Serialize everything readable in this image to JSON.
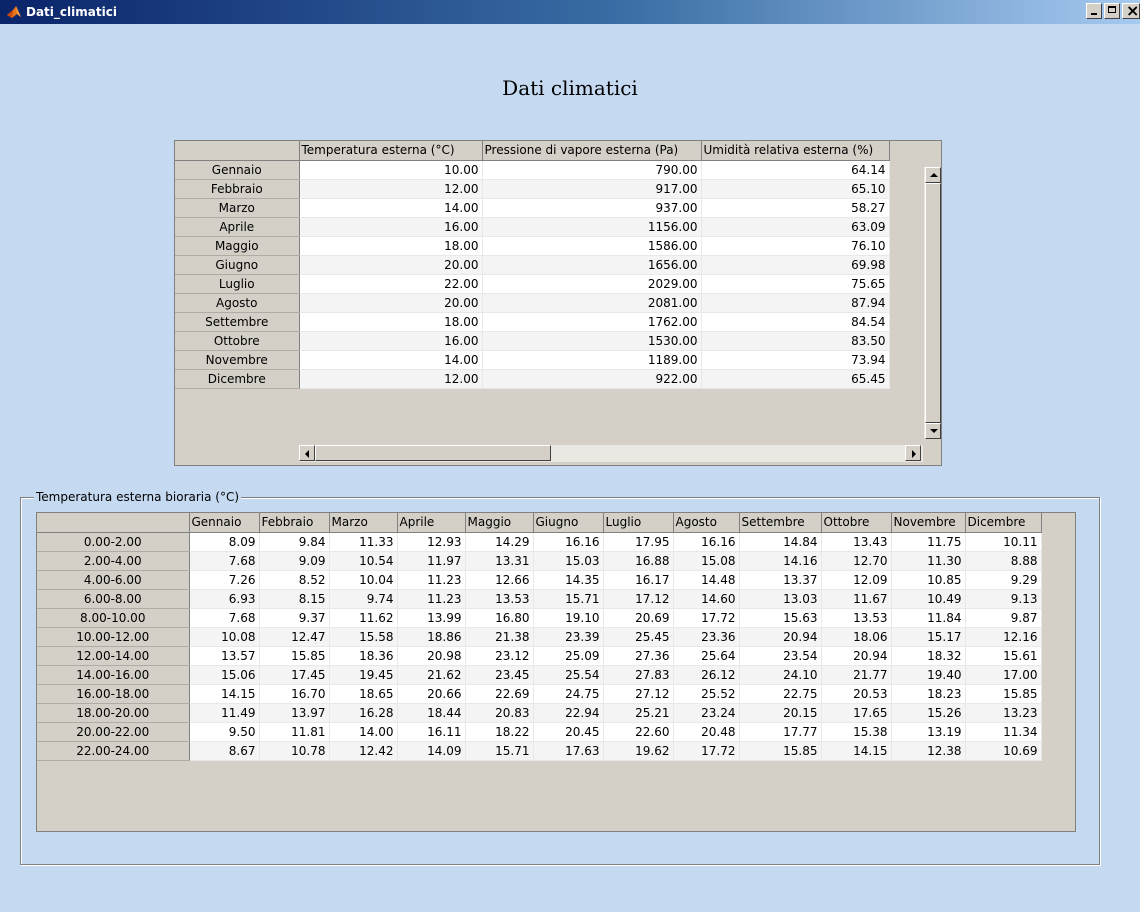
{
  "window": {
    "title": "Dati_climatici",
    "icon": "matlab-icon"
  },
  "heading": "Dati climatici",
  "monthly_table": {
    "columns": [
      "Temperatura esterna  (°C)",
      "Pressione di vapore esterna (Pa)",
      "Umidità relativa esterna (%)"
    ],
    "rows": [
      {
        "label": "Gennaio",
        "values": [
          "10.00",
          "790.00",
          "64.14"
        ]
      },
      {
        "label": "Febbraio",
        "values": [
          "12.00",
          "917.00",
          "65.10"
        ]
      },
      {
        "label": "Marzo",
        "values": [
          "14.00",
          "937.00",
          "58.27"
        ]
      },
      {
        "label": "Aprile",
        "values": [
          "16.00",
          "1156.00",
          "63.09"
        ]
      },
      {
        "label": "Maggio",
        "values": [
          "18.00",
          "1586.00",
          "76.10"
        ]
      },
      {
        "label": "Giugno",
        "values": [
          "20.00",
          "1656.00",
          "69.98"
        ]
      },
      {
        "label": "Luglio",
        "values": [
          "22.00",
          "2029.00",
          "75.65"
        ]
      },
      {
        "label": "Agosto",
        "values": [
          "20.00",
          "2081.00",
          "87.94"
        ]
      },
      {
        "label": "Settembre",
        "values": [
          "18.00",
          "1762.00",
          "84.54"
        ]
      },
      {
        "label": "Ottobre",
        "values": [
          "16.00",
          "1530.00",
          "83.50"
        ]
      },
      {
        "label": "Novembre",
        "values": [
          "14.00",
          "1189.00",
          "73.94"
        ]
      },
      {
        "label": "Dicembre",
        "values": [
          "12.00",
          "922.00",
          "65.45"
        ]
      }
    ]
  },
  "hourly_panel": {
    "title": "Temperatura esterna bioraria (°C)",
    "columns": [
      "Gennaio",
      "Febbraio",
      "Marzo",
      "Aprile",
      "Maggio",
      "Giugno",
      "Luglio",
      "Agosto",
      "Settembre",
      "Ottobre",
      "Novembre",
      "Dicembre"
    ],
    "rows": [
      {
        "label": "0.00-2.00",
        "values": [
          "8.09",
          "9.84",
          "11.33",
          "12.93",
          "14.29",
          "16.16",
          "17.95",
          "16.16",
          "14.84",
          "13.43",
          "11.75",
          "10.11"
        ]
      },
      {
        "label": "2.00-4.00",
        "values": [
          "7.68",
          "9.09",
          "10.54",
          "11.97",
          "13.31",
          "15.03",
          "16.88",
          "15.08",
          "14.16",
          "12.70",
          "11.30",
          "8.88"
        ]
      },
      {
        "label": "4.00-6.00",
        "values": [
          "7.26",
          "8.52",
          "10.04",
          "11.23",
          "12.66",
          "14.35",
          "16.17",
          "14.48",
          "13.37",
          "12.09",
          "10.85",
          "9.29"
        ]
      },
      {
        "label": "6.00-8.00",
        "values": [
          "6.93",
          "8.15",
          "9.74",
          "11.23",
          "13.53",
          "15.71",
          "17.12",
          "14.60",
          "13.03",
          "11.67",
          "10.49",
          "9.13"
        ]
      },
      {
        "label": "8.00-10.00",
        "values": [
          "7.68",
          "9.37",
          "11.62",
          "13.99",
          "16.80",
          "19.10",
          "20.69",
          "17.72",
          "15.63",
          "13.53",
          "11.84",
          "9.87"
        ]
      },
      {
        "label": "10.00-12.00",
        "values": [
          "10.08",
          "12.47",
          "15.58",
          "18.86",
          "21.38",
          "23.39",
          "25.45",
          "23.36",
          "20.94",
          "18.06",
          "15.17",
          "12.16"
        ]
      },
      {
        "label": "12.00-14.00",
        "values": [
          "13.57",
          "15.85",
          "18.36",
          "20.98",
          "23.12",
          "25.09",
          "27.36",
          "25.64",
          "23.54",
          "20.94",
          "18.32",
          "15.61"
        ]
      },
      {
        "label": "14.00-16.00",
        "values": [
          "15.06",
          "17.45",
          "19.45",
          "21.62",
          "23.45",
          "25.54",
          "27.83",
          "26.12",
          "24.10",
          "21.77",
          "19.40",
          "17.00"
        ]
      },
      {
        "label": "16.00-18.00",
        "values": [
          "14.15",
          "16.70",
          "18.65",
          "20.66",
          "22.69",
          "24.75",
          "27.12",
          "25.52",
          "22.75",
          "20.53",
          "18.23",
          "15.85"
        ]
      },
      {
        "label": "18.00-20.00",
        "values": [
          "11.49",
          "13.97",
          "16.28",
          "18.44",
          "20.83",
          "22.94",
          "25.21",
          "23.24",
          "20.15",
          "17.65",
          "15.26",
          "13.23"
        ]
      },
      {
        "label": "20.00-22.00",
        "values": [
          "9.50",
          "11.81",
          "14.00",
          "16.11",
          "18.22",
          "20.45",
          "22.60",
          "20.48",
          "17.77",
          "15.38",
          "13.19",
          "11.34"
        ]
      },
      {
        "label": "22.00-24.00",
        "values": [
          "8.67",
          "10.78",
          "12.42",
          "14.09",
          "15.71",
          "17.63",
          "19.62",
          "17.72",
          "15.85",
          "14.15",
          "12.38",
          "10.69"
        ]
      }
    ]
  }
}
